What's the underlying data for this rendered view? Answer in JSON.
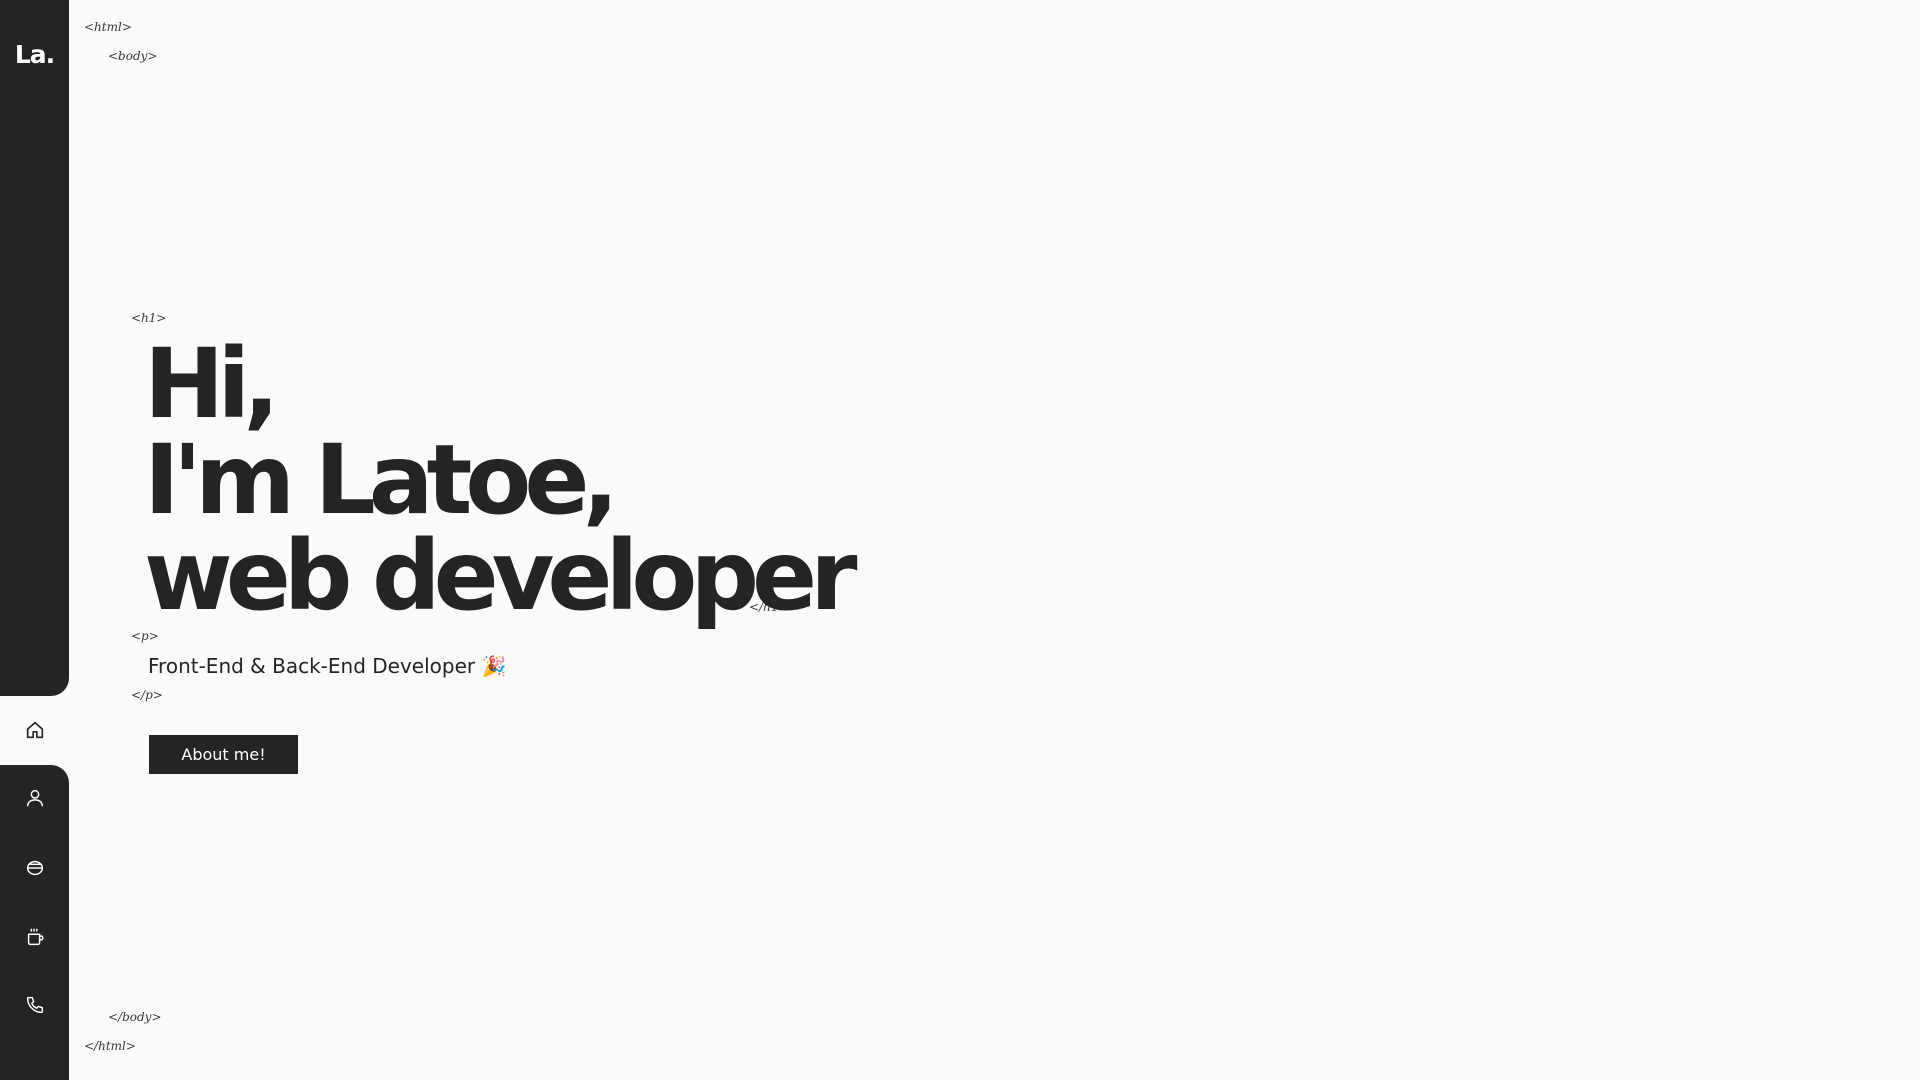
{
  "sidebar": {
    "logo": "La.",
    "nav": [
      {
        "icon": "home-icon",
        "label": "Home"
      },
      {
        "icon": "user-icon",
        "label": "About"
      },
      {
        "icon": "skills-icon",
        "label": "Skills"
      },
      {
        "icon": "coffee-icon",
        "label": "Work"
      },
      {
        "icon": "phone-icon",
        "label": "Contact"
      }
    ],
    "active_index": 0,
    "background": "#242424"
  },
  "tags": {
    "html_open": "<html>",
    "body_open": "<body>",
    "h1_open": "<h1>",
    "h1_close": "</h1>",
    "p_open": "<p>",
    "p_close": "</p>",
    "body_close": "</body>",
    "html_close": "</html>"
  },
  "hero": {
    "line1": "Hi,",
    "line2": "I'm Latoe,",
    "line3": "web developer",
    "subtitle": "Front-End & Back-End Developer 🎉",
    "button_label": "About me!"
  },
  "colors": {
    "page_bg": "#fafafa",
    "text": "#242424",
    "button_bg": "#242424",
    "button_text": "#ffffff"
  }
}
